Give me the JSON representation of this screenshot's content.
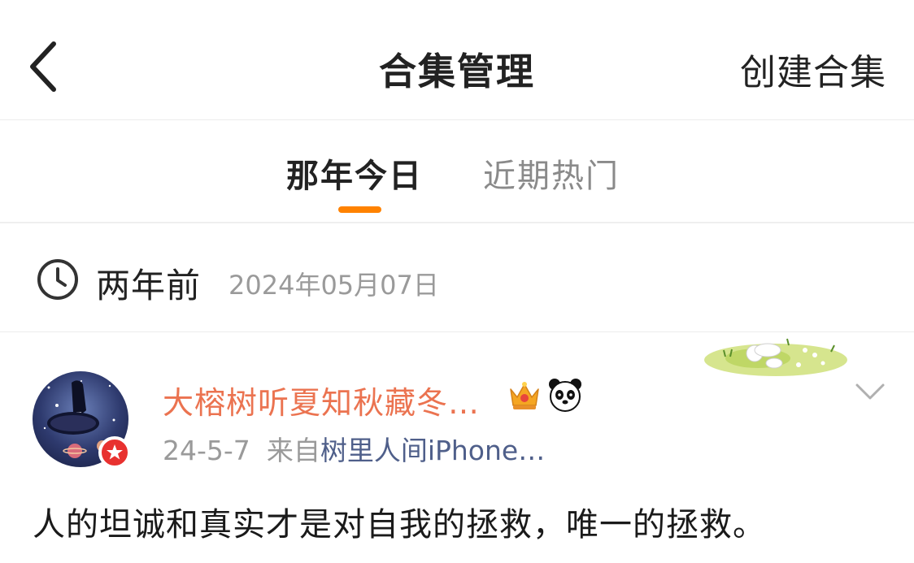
{
  "header": {
    "title": "合集管理",
    "create_label": "创建合集",
    "back_icon": "chevron-left-icon"
  },
  "tabs": [
    {
      "label": "那年今日",
      "active": true
    },
    {
      "label": "近期热门",
      "active": false
    }
  ],
  "accent_color": "#ff8200",
  "time_section": {
    "label": "两年前",
    "date": "2024年05月07日",
    "icon": "clock-icon"
  },
  "post": {
    "username": "大榕树听夏知秋藏冬…",
    "username_color": "#eb7350",
    "date": "24-5-7",
    "from_label": "来自",
    "source": "树里人间iPhone…",
    "source_color": "#4f5f8a",
    "text": "人的坦诚和真实才是对自我的拯救，唯一的拯救。",
    "badges": [
      "crown-icon",
      "panda-icon"
    ]
  }
}
